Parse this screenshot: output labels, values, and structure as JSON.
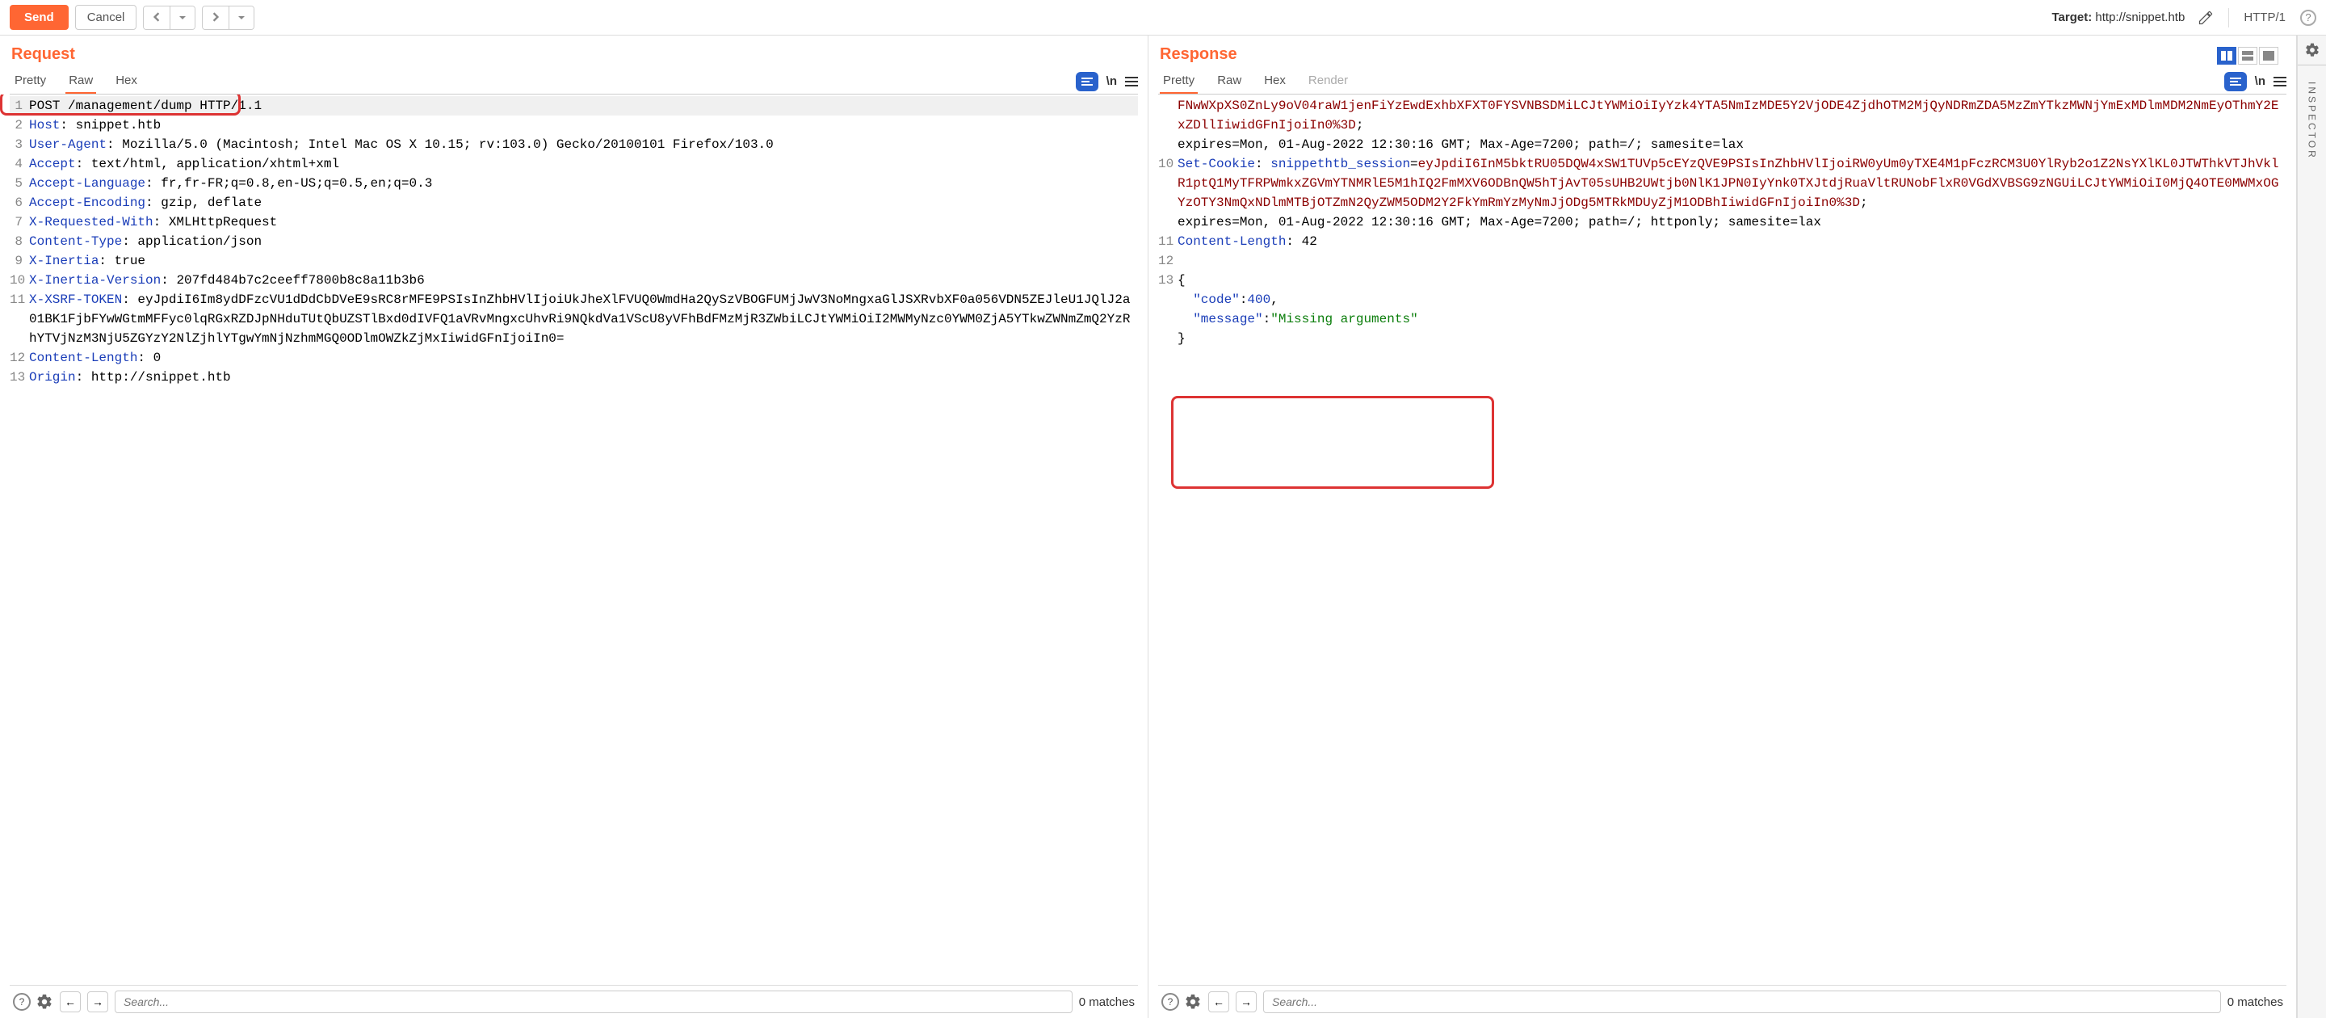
{
  "toolbar": {
    "send": "Send",
    "cancel": "Cancel",
    "target_label": "Target: ",
    "target_value": "http://snippet.htb",
    "http_version": "HTTP/1"
  },
  "request": {
    "title": "Request",
    "tabs": {
      "pretty": "Pretty",
      "raw": "Raw",
      "hex": "Hex"
    },
    "lines": [
      {
        "n": 1,
        "plain": "POST /management/dump HTTP/1.1"
      },
      {
        "n": 2,
        "h": "Host",
        "v": "snippet.htb"
      },
      {
        "n": 3,
        "h": "User-Agent",
        "v": "Mozilla/5.0 (Macintosh; Intel Mac OS X 10.15; rv:103.0) Gecko/20100101 Firefox/103.0"
      },
      {
        "n": 4,
        "h": "Accept",
        "v": "text/html, application/xhtml+xml"
      },
      {
        "n": 5,
        "h": "Accept-Language",
        "v": "fr,fr-FR;q=0.8,en-US;q=0.5,en;q=0.3"
      },
      {
        "n": 6,
        "h": "Accept-Encoding",
        "v": "gzip, deflate"
      },
      {
        "n": 7,
        "h": "X-Requested-With",
        "v": "XMLHttpRequest"
      },
      {
        "n": 8,
        "h": "Content-Type",
        "v": "application/json"
      },
      {
        "n": 9,
        "h": "X-Inertia",
        "v": "true"
      },
      {
        "n": 10,
        "h": "X-Inertia-Version",
        "v": "207fd484b7c2ceeff7800b8c8a11b3b6"
      },
      {
        "n": 11,
        "h": "X-XSRF-TOKEN",
        "v": "eyJpdiI6Im8ydDFzcVU1dDdCbDVeE9sRC8rMFE9PSIsInZhbHVlIjoiUkJheXlFVUQ0WmdHa2QySzVBOGFUMjJwV3NoMngxaGlJSXRvbXF0a056VDN5ZEJleU1JQlJ2a01BK1FjbFYwWGtmMFFyc0lqRGxRZDJpNHduTUtQbUZSTlBxd0dIVFQ1aVRvMngxcUhvRi9NQkdVa1VScU8yVFhBdFMzMjR3ZWbiLCJtYWMiOiI2MWMyNzc0YWM0ZjA5YTkwZWNmZmQ2YzRhYTVjNzM3NjU5ZGYzY2NlZjhlYTgwYmNjNzhmMGQ0ODlmOWZkZjMxIiwidGFnIjoiIn0="
      },
      {
        "n": 12,
        "h": "Content-Length",
        "v": "0"
      },
      {
        "n": 13,
        "h": "Origin",
        "v": "http://snippet.htb"
      }
    ]
  },
  "response": {
    "title": "Response",
    "tabs": {
      "pretty": "Pretty",
      "raw": "Raw",
      "hex": "Hex",
      "render": "Render"
    },
    "prelines": {
      "cookie_frag": "FNwWXpXS0ZnLy9oV04raW1jenFiYzEwdExhbXFXT0FYSVNBSDMiLCJtYWMiOiIyYzk4YTA5NmIzMDE5Y2VjODE4ZjdhOTM2MjQyNDRmZDA5MzZmYTkzMWNjYmExMDlmMDM2NmEyOThmY2ExZDllIiwidGFnIjoiIn0%3D",
      "exp1": "expires=Mon, 01-Aug-2022 12:30:16 GMT; Max-Age=7200; path=/; samesite=lax"
    },
    "setcookie": {
      "num": 10,
      "name": "Set-Cookie",
      "key": "snippethtb_session",
      "val": "eyJpdiI6InM5bktRU05DQW4xSW1TUVp5cEYzQVE9PSIsInZhbHVlIjoiRW0yUm0yTXE4M1pFczRCM3U0YlRyb2o1Z2NsYXlKL0JTWThkVTJhVklR1ptQ1MyTFRPWmkxZGVmYTNMRlE5M1hIQ2FmMXV6ODBnQW5hTjAvT05sUHB2UWtjb0NlK1JPN0IyYnk0TXJtdjRuaVltRUNobFlxR0VGdXVBSG9zNGUiLCJtYWMiOiI0MjQ4OTE0MWMxOGYzOTY3NmQxNDlmMTBjOTZmN2QyZWM5ODM2Y2FkYmRmYzMyNmJjODg5MTRkMDUyZjM1ODBhIiwidGFnIjoiIn0%3D",
      "exp2": "expires=Mon, 01-Aug-2022 12:30:16 GMT; Max-Age=7200; path=/; httponly; samesite=lax"
    },
    "content_length": {
      "num": 11,
      "name": "Content-Length",
      "val": "42"
    },
    "blank": 12,
    "body": {
      "num": 13,
      "open": "{",
      "k1": "\"code\"",
      "v1": "400",
      "c": ",",
      "k2": "\"message\"",
      "v2": "\"Missing arguments\"",
      "close": "}"
    }
  },
  "search": {
    "placeholder": "Search...",
    "matches": "0 matches"
  },
  "sidebar": {
    "label": "INSPECTOR"
  }
}
